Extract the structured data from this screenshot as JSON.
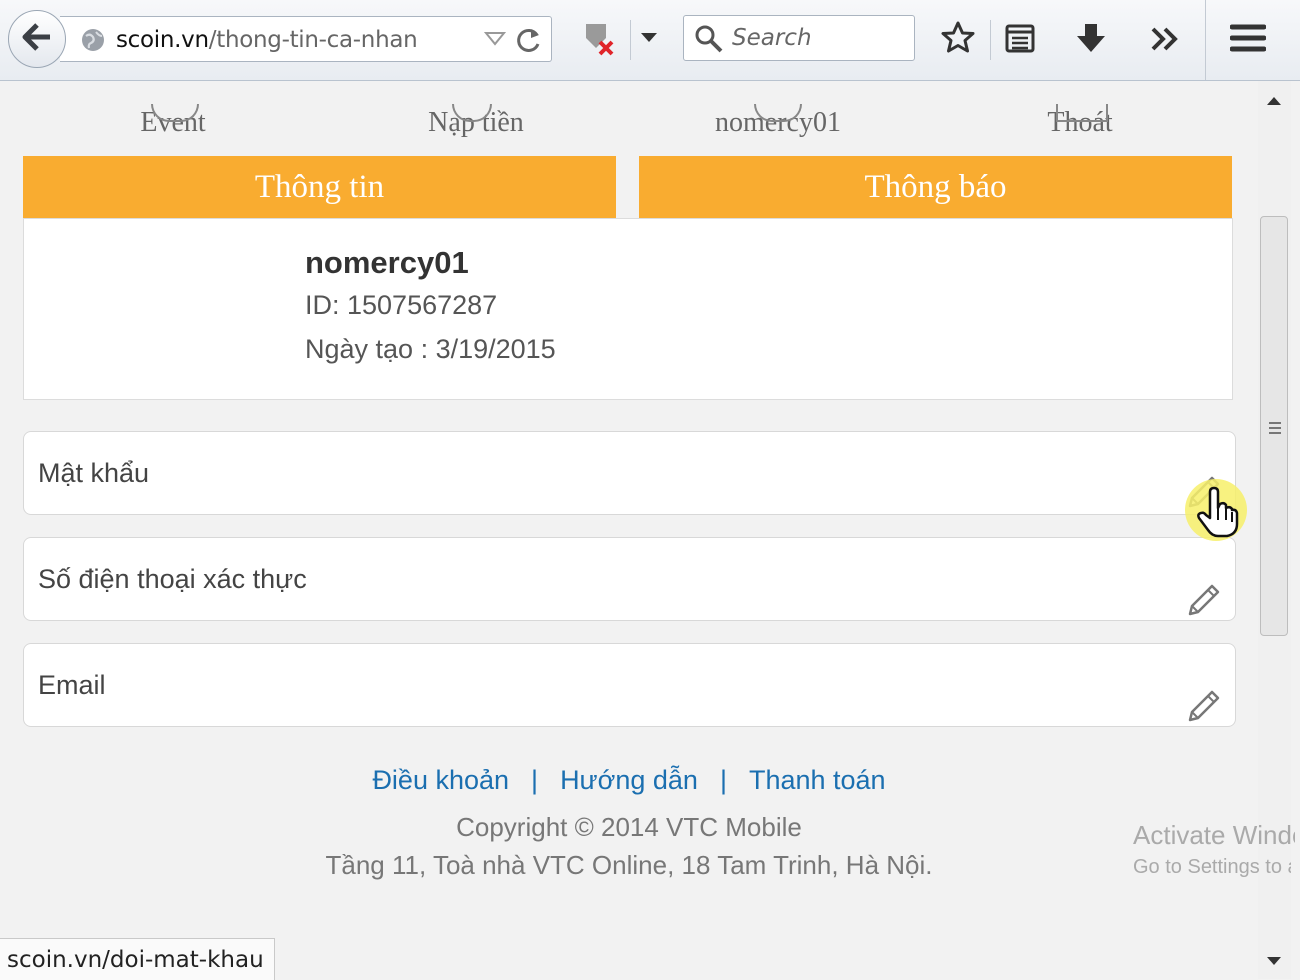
{
  "browser": {
    "url_host": "scoin.vn",
    "url_path": "/thong-tin-ca-nhan",
    "search_placeholder": "Search",
    "status_url": "scoin.vn/doi-mat-khau"
  },
  "nav": {
    "items": [
      {
        "label": "Event"
      },
      {
        "label": "Nạp tiền"
      },
      {
        "label": "nomercy01"
      },
      {
        "label": "Thoát"
      }
    ]
  },
  "tabs": [
    {
      "label": "Thông tin"
    },
    {
      "label": "Thông báo"
    }
  ],
  "profile": {
    "username": "nomercy01",
    "id_text": "ID: 1507567287",
    "created_text": "Ngày tạo : 3/19/2015"
  },
  "fields": [
    {
      "label": "Mật khẩu"
    },
    {
      "label": "Số điện thoại xác thực"
    },
    {
      "label": "Email"
    }
  ],
  "footer": {
    "links": [
      "Điều khoản",
      "Hướng dẫn",
      "Thanh toán"
    ],
    "separator": "|",
    "copyright": "Copyright © 2014 VTC Mobile",
    "address": "Tầng 11, Toà nhà VTC Online, 18 Tam Trinh, Hà Nội."
  },
  "watermark": {
    "title": "Activate Windows",
    "subtitle": "Go to Settings to activate Windows."
  },
  "colors": {
    "tab_accent": "#f9ac30",
    "link": "#1b6fb0"
  },
  "icons": [
    "back-arrow-icon",
    "globe-icon",
    "dropdown-icon",
    "reload-icon",
    "addon-blocked-icon",
    "search-icon",
    "bookmark-star-icon",
    "reading-list-icon",
    "download-icon",
    "overflow-chevron-icon",
    "hamburger-menu-icon",
    "pencil-icon",
    "hand-cursor-icon"
  ]
}
